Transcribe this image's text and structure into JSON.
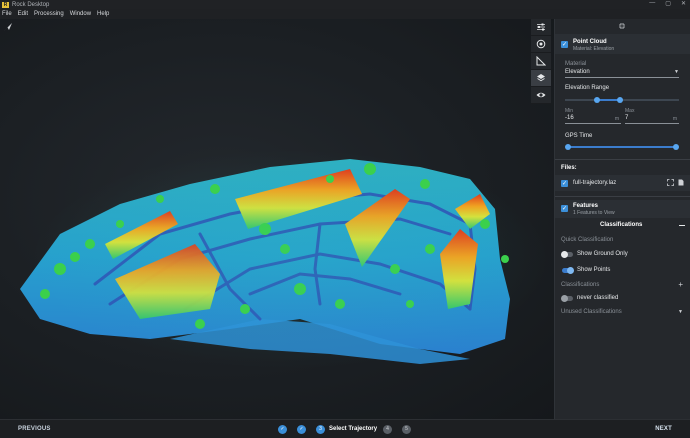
{
  "window": {
    "title": "Rock Desktop",
    "logo_letter": "R",
    "controls": [
      "—",
      "▢",
      "✕"
    ]
  },
  "menu": [
    "File",
    "Edit",
    "Processing",
    "Window",
    "Help"
  ],
  "toolstrip": [
    {
      "icon": "sliders-icon",
      "active": false
    },
    {
      "icon": "target-icon",
      "active": false
    },
    {
      "icon": "ruler-icon",
      "active": false
    },
    {
      "icon": "layers-icon",
      "active": true
    },
    {
      "icon": "eye-icon",
      "active": false
    }
  ],
  "panel": {
    "point_cloud": {
      "title": "Point Cloud",
      "subtitle": "Material: Elevation",
      "material_label": "Material",
      "material_value": "Elevation",
      "elevation_range_label": "Elevation Range",
      "elevation_range_fraction": [
        0.27,
        0.48
      ],
      "min_label": "Min",
      "max_label": "Max",
      "min_value": "-16",
      "max_value": "7",
      "unit": "m",
      "gps_time_label": "GPS Time",
      "gps_time_fraction": [
        0.0,
        1.0
      ]
    },
    "files": {
      "header": "Files:",
      "items": [
        {
          "name": "full-trajectory.laz"
        }
      ]
    },
    "features": {
      "title": "Features",
      "subtitle": "1 Features to View",
      "classifications_header": "Classifications",
      "quick_classification_label": "Quick Classification",
      "show_ground_only": {
        "label": "Show Ground Only",
        "on": false
      },
      "show_points": {
        "label": "Show Points",
        "on": true
      },
      "classifications_label": "Classifications",
      "add_symbol": "+",
      "never_classified": {
        "label": "never classified",
        "on": false
      },
      "unused_classifications_label": "Unused Classifications"
    }
  },
  "bottom": {
    "previous_label": "PREVIOUS",
    "next_label": "NEXT",
    "steps": [
      {
        "state": "done",
        "text": "✓"
      },
      {
        "state": "done",
        "text": "✓"
      },
      {
        "state": "current",
        "text": "3",
        "label": "Select Trajectory"
      },
      {
        "state": "todo",
        "text": "4"
      },
      {
        "state": "todo",
        "text": "5"
      }
    ]
  },
  "colors": {
    "accent": "#3b8fd9",
    "panel_bg": "#25282c",
    "viewport_bg": "#1b1f23"
  }
}
